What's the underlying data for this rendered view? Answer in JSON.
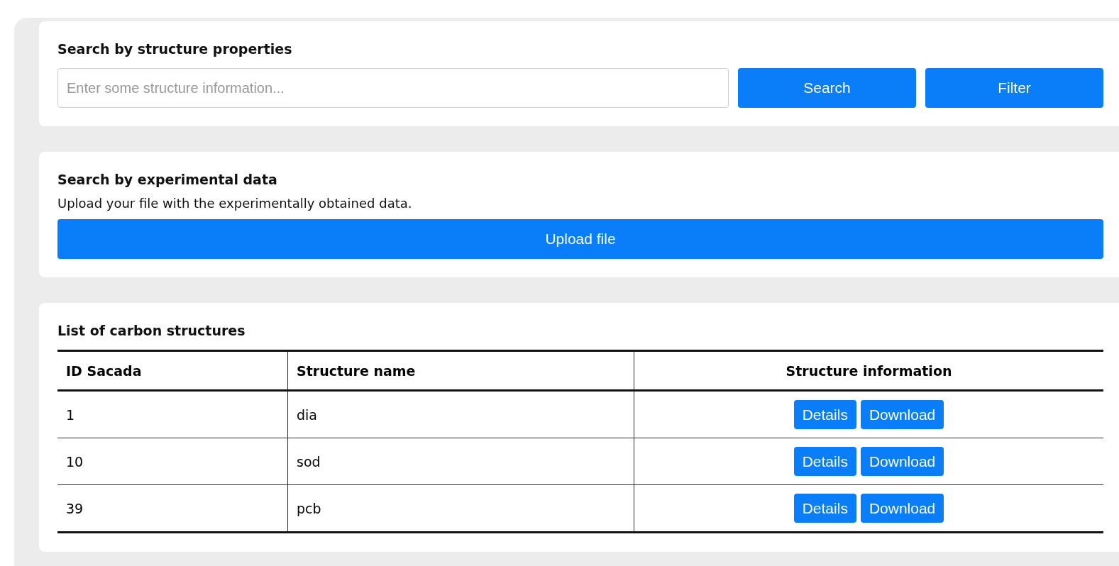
{
  "structure_search": {
    "title": "Search by structure properties",
    "search_field": {
      "placeholder": "Enter some structure information..."
    },
    "buttons": [
      "Search",
      "Filter"
    ]
  },
  "experimental_search": {
    "title": "Search by experimental data",
    "description": "Upload your file with the experimentally obtained data.",
    "button": "Upload file"
  },
  "structures": {
    "title": "List of carbon structures",
    "columns": [
      "ID Sacada",
      "Structure name",
      "Structure information"
    ],
    "rows": [
      {
        "id": "1",
        "name": "dia",
        "actions": [
          "Details",
          "Download"
        ]
      },
      {
        "id": "10",
        "name": "sod",
        "actions": [
          "Details",
          "Download"
        ]
      },
      {
        "id": "39",
        "name": "pcb",
        "actions": [
          "Details",
          "Download"
        ]
      }
    ]
  }
}
